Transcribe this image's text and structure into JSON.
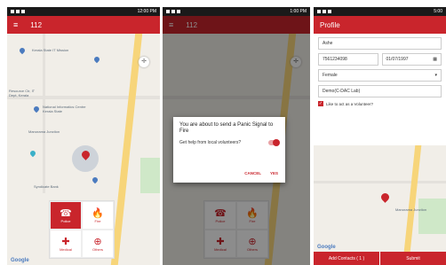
{
  "screens": {
    "home": {
      "app_title": "112",
      "status_time": "12:00 PM",
      "map_labels": [
        "Kerala State IT Mission",
        "Resource Ctr, IT Dept, Kerala",
        "National Informatics Centre Kerala State",
        "Manorama Junction",
        "Syndicate Bank"
      ],
      "services": [
        {
          "label": "Police",
          "icon": "phone-icon",
          "active": true
        },
        {
          "label": "Fire",
          "icon": "fire-icon",
          "active": false
        },
        {
          "label": "Medical",
          "icon": "ambulance-icon",
          "active": false
        },
        {
          "label": "Others",
          "icon": "lifebuoy-icon",
          "active": false
        }
      ],
      "google": "Google"
    },
    "panic": {
      "app_title": "112",
      "status_time": "1:00 PM",
      "dialog_title": "You are about to send a Panic Signal to Fire",
      "dialog_question": "Get help from local volunteers?",
      "cancel": "CANCEL",
      "yes": "YES",
      "services": [
        {
          "label": "Police",
          "icon": "phone-icon"
        },
        {
          "label": "Fire",
          "icon": "fire-icon"
        },
        {
          "label": "Medical",
          "icon": "ambulance-icon"
        },
        {
          "label": "Others",
          "icon": "lifebuoy-icon"
        }
      ]
    },
    "profile": {
      "app_title": "Profile",
      "status_time": "5:00",
      "name": "Ashe",
      "phone": "7561234098",
      "dob": "01/07/1997",
      "gender": "Female",
      "organization": "Demo(C-DAC Lab)",
      "volunteer_label": "Like to act as a Volunteer?",
      "add_contacts": "Add Contacts ( 1 )",
      "submit": "Submit",
      "map_label": "Manorama Junction",
      "google": "Google"
    }
  },
  "colors": {
    "brand_red": "#c9252c",
    "road_yellow": "#f7d57a"
  }
}
